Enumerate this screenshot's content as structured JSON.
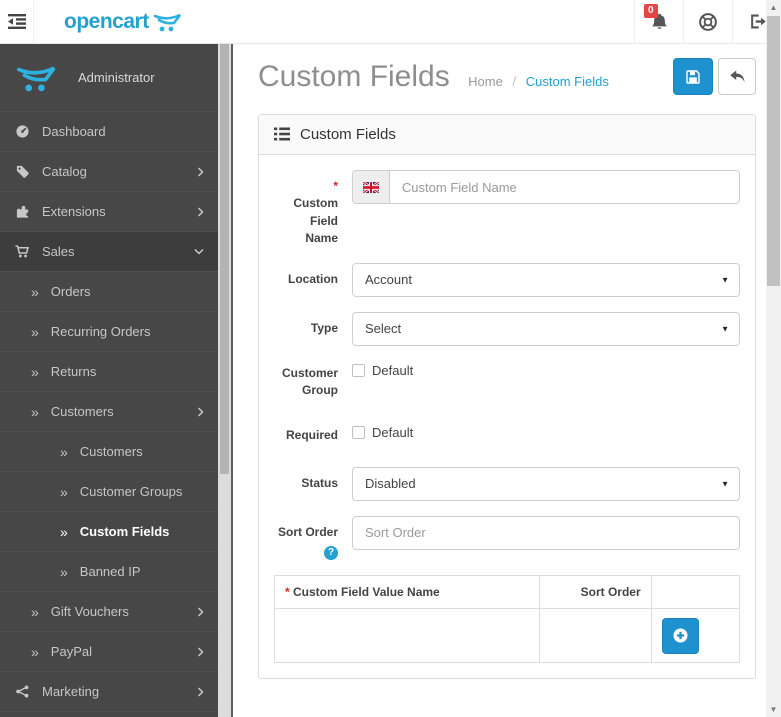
{
  "colors": {
    "accent_blue": "#1e91cf",
    "link_blue": "#23a1d1",
    "badge_red": "#e64545",
    "required_red": "#e02222",
    "sidebar_bg": "#474747"
  },
  "icons_legend": {
    "menu-toggle-icon": "outdent bars",
    "bell-icon": "notification bell",
    "life-ring-icon": "support",
    "sign-out-icon": "logout",
    "cart-logo-icon": "opencart swoosh cart",
    "flag-icon": "uk-flag"
  },
  "icons": {
    "double_angle": "»",
    "caret_down": "▼",
    "question_mark": "?",
    "scroll_up": "▲",
    "scroll_down": "▼"
  },
  "header": {
    "logo_text": "opencart",
    "notification_badge": "0"
  },
  "sidebar": {
    "profile_name": "Administrator",
    "items": [
      {
        "label": "Dashboard",
        "icon": "dashboard-icon",
        "level": 0
      },
      {
        "label": "Catalog",
        "icon": "tag-icon",
        "level": 0,
        "chevron": "right"
      },
      {
        "label": "Extensions",
        "icon": "puzzle-icon",
        "level": 0,
        "chevron": "right"
      },
      {
        "label": "Sales",
        "icon": "cart-icon",
        "level": 0,
        "chevron": "down",
        "expanded": true
      },
      {
        "label": "Orders",
        "level": 1
      },
      {
        "label": "Recurring Orders",
        "level": 1
      },
      {
        "label": "Returns",
        "level": 1
      },
      {
        "label": "Customers",
        "level": 1,
        "chevron": "right"
      },
      {
        "label": "Customers",
        "level": 2
      },
      {
        "label": "Customer Groups",
        "level": 2
      },
      {
        "label": "Custom Fields",
        "level": 2,
        "active": true
      },
      {
        "label": "Banned IP",
        "level": 2
      },
      {
        "label": "Gift Vouchers",
        "level": 1,
        "chevron": "right"
      },
      {
        "label": "PayPal",
        "level": 1,
        "chevron": "right"
      },
      {
        "label": "Marketing",
        "icon": "share-icon",
        "level": 0,
        "chevron": "right"
      }
    ]
  },
  "page": {
    "title": "Custom Fields",
    "breadcrumb_home": "Home",
    "breadcrumb_sep": "/",
    "breadcrumb_current": "Custom Fields"
  },
  "panel": {
    "title": "Custom Fields"
  },
  "form": {
    "required_mark": "*",
    "custom_field_name": {
      "label": "Custom Field Name",
      "placeholder": "Custom Field Name"
    },
    "location": {
      "label": "Location",
      "value": "Account"
    },
    "type": {
      "label": "Type",
      "value": "Select"
    },
    "customer_group": {
      "label": "Customer Group",
      "option": "Default",
      "checked": false
    },
    "required": {
      "label": "Required",
      "option": "Default",
      "checked": false
    },
    "status": {
      "label": "Status",
      "value": "Disabled"
    },
    "sort_order": {
      "label": "Sort Order",
      "placeholder": "Sort Order"
    }
  },
  "values_table": {
    "col_name": "Custom Field Value Name",
    "col_sort": "Sort Order",
    "rows": []
  }
}
